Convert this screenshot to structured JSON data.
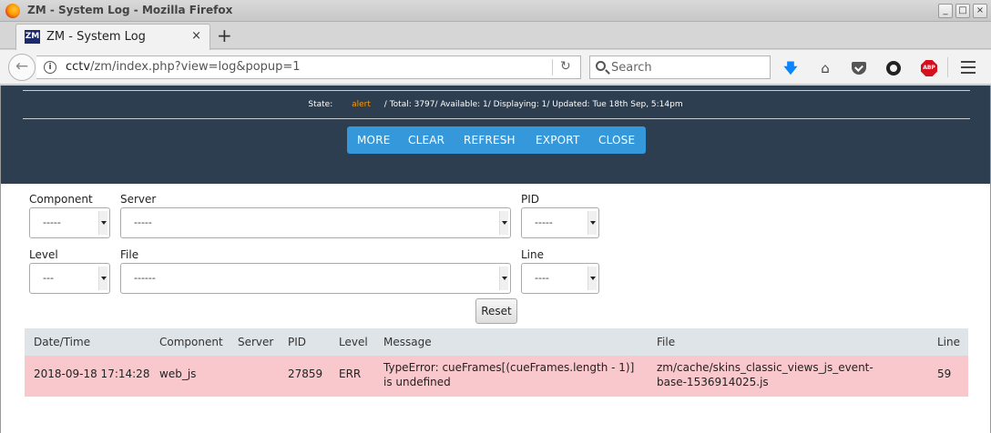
{
  "window": {
    "title": "ZM - System Log - Mozilla Firefox",
    "controls": {
      "minimize": "_",
      "maximize": "□",
      "close": "×"
    }
  },
  "tab": {
    "title": "ZM - System Log",
    "favicon": "ZM",
    "close": "×",
    "new_tab": "+"
  },
  "nav": {
    "url_host": "cctv",
    "url_path": "/zm/index.php?view=log&popup=1",
    "search_placeholder": "Search",
    "icons": [
      "back-arrow-icon",
      "info-icon",
      "reload-icon",
      "search-icon",
      "download-icon",
      "home-icon",
      "pocket-icon",
      "sync-icon",
      "adblock-icon",
      "hamburger-menu-icon"
    ]
  },
  "status": {
    "label": "State:",
    "state": "alert",
    "summary": "/ Total: 3797/ Available: 1/ Displaying: 1/ Updated: Tue 18th Sep, 5:14pm",
    "state_color": "#f39c12"
  },
  "buttons": {
    "more": "MORE",
    "clear": "CLEAR",
    "refresh": "REFRESH",
    "export": "EXPORT",
    "close": "CLOSE"
  },
  "filters": {
    "component": {
      "label": "Component",
      "value": "-----"
    },
    "server": {
      "label": "Server",
      "value": "-----"
    },
    "pid": {
      "label": "PID",
      "value": "-----"
    },
    "level": {
      "label": "Level",
      "value": "---"
    },
    "file": {
      "label": "File",
      "value": "------"
    },
    "line": {
      "label": "Line",
      "value": "----"
    },
    "reset": "Reset"
  },
  "table": {
    "columns": [
      "Date/Time",
      "Component",
      "Server",
      "PID",
      "Level",
      "Message",
      "File",
      "Line"
    ],
    "rows": [
      {
        "datetime": "2018-09-18 17:14:28",
        "component": "web_js",
        "server": "",
        "pid": "27859",
        "level": "ERR",
        "message_1": "TypeError: cueFrames[(cueFrames.length - 1)]",
        "message_2": "is undefined",
        "file_1": "zm/cache/skins_classic_views_js_event-",
        "file_2": "base-1536914025.js",
        "line": "59"
      }
    ]
  },
  "colors": {
    "header_bg": "#2c3e50",
    "button_bg": "#3498db",
    "error_row_bg": "#f8c8cc",
    "table_head_bg": "#dfe4e8"
  }
}
